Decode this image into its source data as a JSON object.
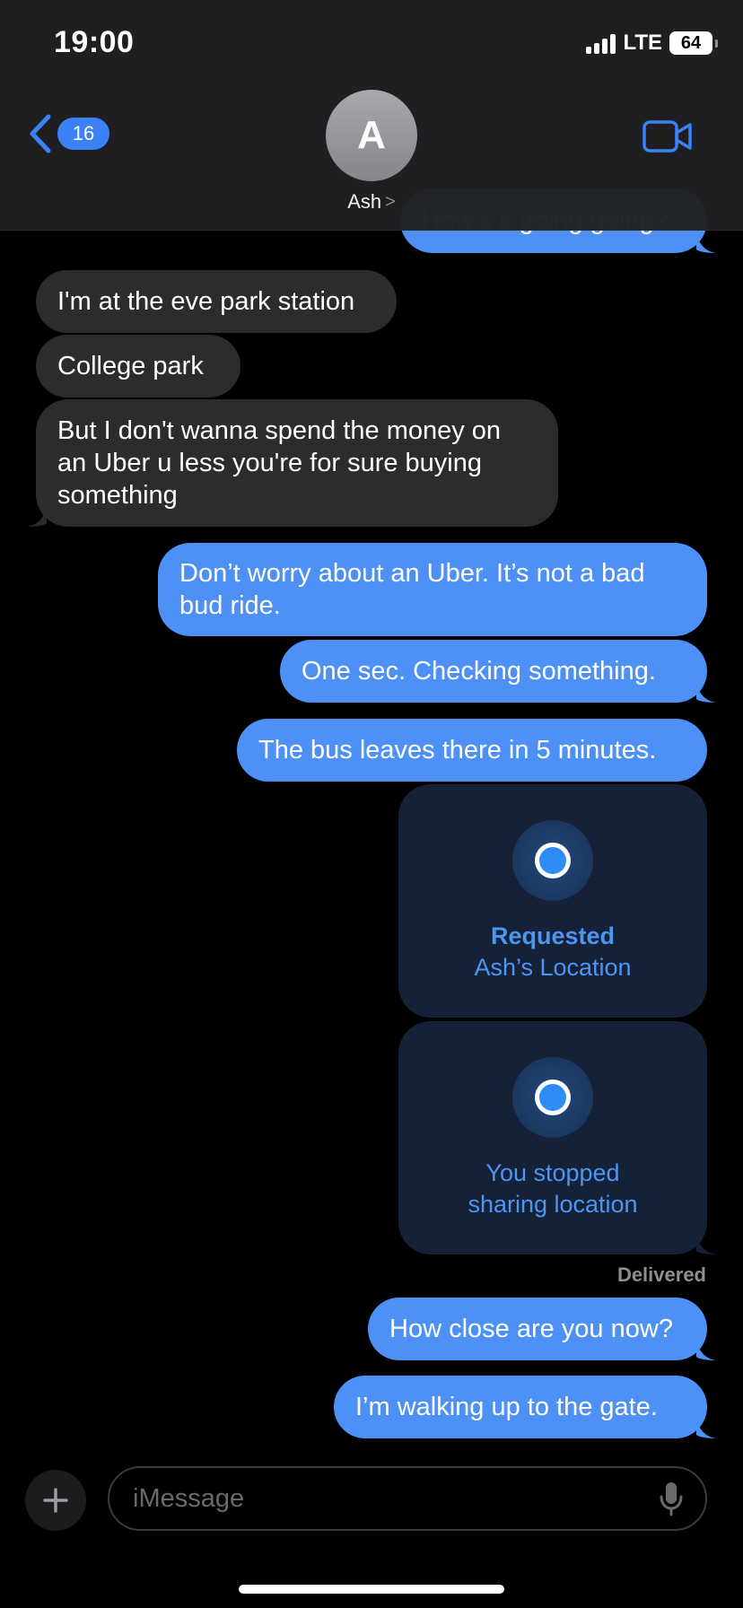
{
  "status_bar": {
    "time": "19:00",
    "network": "LTE",
    "battery": "64"
  },
  "header": {
    "back_badge": "16",
    "avatar_initial": "A",
    "contact_name": "Ash",
    "contact_chevron": ">"
  },
  "messages": [
    {
      "direction": "outgoing",
      "text": "How's it going going?"
    },
    {
      "direction": "incoming",
      "text": "I'm at the eve park station"
    },
    {
      "direction": "incoming",
      "text": "College park"
    },
    {
      "direction": "incoming",
      "text": "But I don't wanna spend the money on an Uber u less you're for sure buying something"
    },
    {
      "direction": "outgoing",
      "text": "Don’t worry about an Uber. It’s not a bad bud ride."
    },
    {
      "direction": "outgoing",
      "text": "One sec. Checking something."
    },
    {
      "direction": "outgoing",
      "text": "The bus leaves there in 5 minutes."
    },
    {
      "direction": "outgoing",
      "text": "How close are you now?"
    },
    {
      "direction": "outgoing",
      "text": "I’m walking up to the gate."
    }
  ],
  "location_cards": [
    {
      "title": "Requested",
      "subtitle": "Ash’s Location"
    },
    {
      "line1": "You stopped",
      "line2": "sharing location"
    }
  ],
  "delivered_label": "Delivered",
  "input": {
    "placeholder": "iMessage",
    "value": ""
  },
  "icons": {
    "back": "chevron-left-icon",
    "video": "video-camera-icon",
    "plus": "plus-icon",
    "mic": "microphone-icon",
    "signal": "signal-bars-icon",
    "battery": "battery-icon"
  },
  "colors": {
    "outgoing_bubble": "#4d91f6",
    "incoming_bubble": "#2c2c2e",
    "accent": "#3b82f6",
    "location_card": "#152136",
    "location_text": "#4c95f3"
  }
}
